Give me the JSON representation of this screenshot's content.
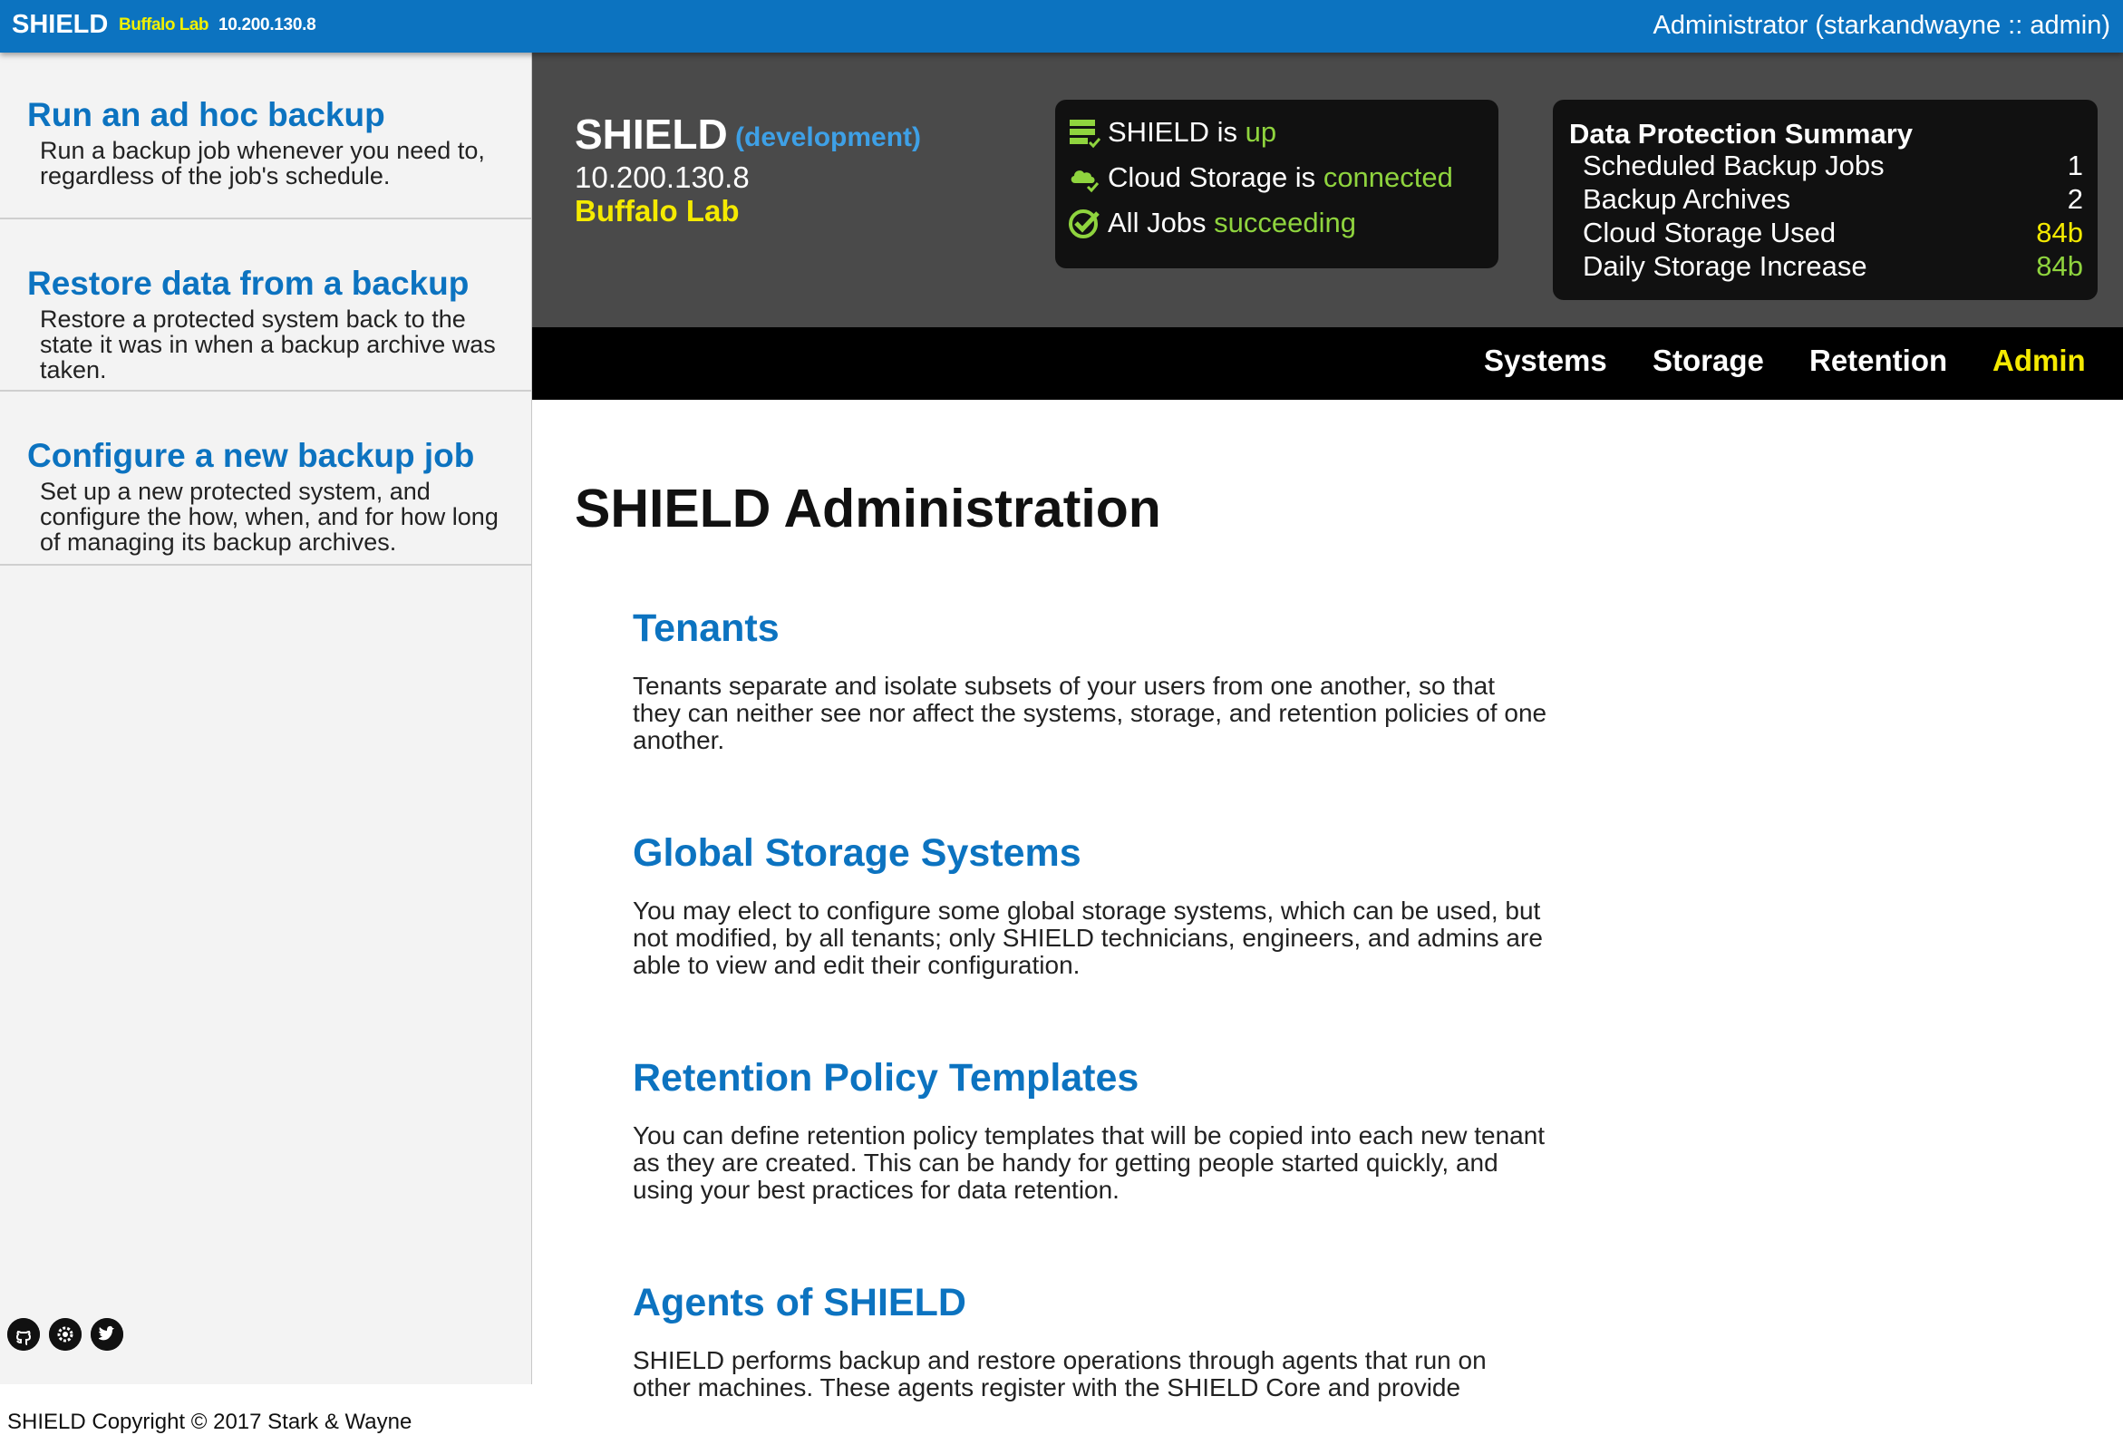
{
  "topbar": {
    "brand": "SHIELD",
    "lab": "Buffalo Lab",
    "ip": "10.200.130.8",
    "user": "Administrator (starkandwayne :: admin)"
  },
  "sidebar": {
    "items": [
      {
        "title": "Run an ad hoc backup",
        "desc": "Run a backup job whenever you need to, regardless of the job's schedule."
      },
      {
        "title": "Restore data from a backup",
        "desc": "Restore a protected system back to the state it was in when a backup archive was taken."
      },
      {
        "title": "Configure a new backup job",
        "desc": "Set up a new protected system, and configure the how, when, and for how long of managing its backup archives."
      }
    ],
    "social_icons": [
      "github-icon",
      "gear-icon",
      "twitter-icon"
    ],
    "copyright": "SHIELD Copyright © 2017 Stark & Wayne"
  },
  "header": {
    "name": "SHIELD",
    "env": "(development)",
    "ip": "10.200.130.8",
    "lab": "Buffalo Lab"
  },
  "status": {
    "core": {
      "prefix": "SHIELD is ",
      "value": "up",
      "icon": "server-icon"
    },
    "storage": {
      "prefix": "Cloud Storage is ",
      "value": "connected",
      "icon": "cloud-icon"
    },
    "jobs": {
      "prefix": "All Jobs ",
      "value": "succeeding",
      "icon": "check-circle-icon"
    }
  },
  "summary": {
    "title": "Data Protection Summary",
    "rows": [
      {
        "label": "Scheduled Backup Jobs",
        "value": "1"
      },
      {
        "label": "Backup Archives",
        "value": "2"
      },
      {
        "label": "Cloud Storage Used",
        "value": "84b"
      },
      {
        "label": "Daily Storage Increase",
        "value": "84b"
      }
    ]
  },
  "nav": {
    "systems": "Systems",
    "storage": "Storage",
    "retention": "Retention",
    "admin": "Admin"
  },
  "colors": {
    "brand_blue": "#0c73c0",
    "status_green": "#8fd43e",
    "highlight_yellow": "#f5ea00"
  },
  "main": {
    "title": "SHIELD Administration",
    "sections": [
      {
        "heading": "Tenants",
        "text": "Tenants separate and isolate subsets of your users from one another, so that they can neither see nor affect the systems, storage, and retention policies of one another."
      },
      {
        "heading": "Global Storage Systems",
        "text": "You may elect to configure some global storage systems, which can be used, but not modified, by all tenants; only SHIELD technicians, engineers, and admins are able to view and edit their configuration."
      },
      {
        "heading": "Retention Policy Templates",
        "text": "You can define retention policy templates that will be copied into each new tenant as they are created. This can be handy for getting people started quickly, and using your best practices for data retention."
      },
      {
        "heading": "Agents of SHIELD",
        "text": "SHIELD performs backup and restore operations through agents that run on other machines. These agents register with the SHIELD Core and provide"
      }
    ]
  }
}
